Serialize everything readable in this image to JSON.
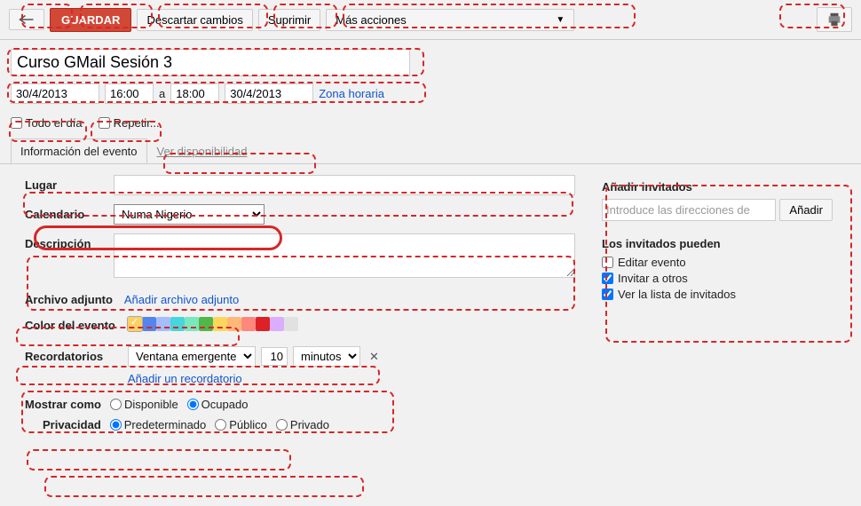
{
  "toolbar": {
    "save": "GUARDAR",
    "discard": "Descartar cambios",
    "delete": "Suprimir",
    "more": "Más acciones"
  },
  "event": {
    "title": "Curso GMail Sesión 3",
    "startDate": "30/4/2013",
    "startTime": "16:00",
    "to": "a",
    "endTime": "18:00",
    "endDate": "30/4/2013",
    "tzLink": "Zona horaria",
    "allDay": "Todo el día",
    "repeat": "Repetir..."
  },
  "tabs": {
    "info": "Información del evento",
    "avail": "Ver disponibilidad"
  },
  "form": {
    "placeLabel": "Lugar",
    "placeValue": "",
    "calLabel": "Calendario",
    "calValue": "Numa Nigerio",
    "descLabel": "Descripción",
    "descValue": ""
  },
  "attach": {
    "label": "Archivo adjunto",
    "link": "Añadir archivo adjunto"
  },
  "colors": {
    "label": "Color del evento",
    "swatches": [
      "#fad165",
      "#5484ed",
      "#a4bdfc",
      "#46d6db",
      "#7ae7bf",
      "#51b749",
      "#fbd75b",
      "#ffb878",
      "#ff887c",
      "#dc2127",
      "#dbadff",
      "#e1e1e1"
    ],
    "selected": 0
  },
  "reminders": {
    "label": "Recordatorios",
    "method": "Ventana emergente",
    "amount": "10",
    "unit": "minutos",
    "addLink": "Añadir un recordatorio"
  },
  "showAs": {
    "label": "Mostrar como",
    "available": "Disponible",
    "busy": "Ocupado"
  },
  "privacy": {
    "label": "Privacidad",
    "default": "Predeterminado",
    "public": "Público",
    "private": "Privado"
  },
  "guests": {
    "title": "Añadir invitados",
    "placeholder": "Introduce las direcciones de",
    "add": "Añadir",
    "permsTitle": "Los invitados pueden",
    "edit": "Editar evento",
    "invite": "Invitar a otros",
    "seeList": "Ver la lista de invitados"
  }
}
